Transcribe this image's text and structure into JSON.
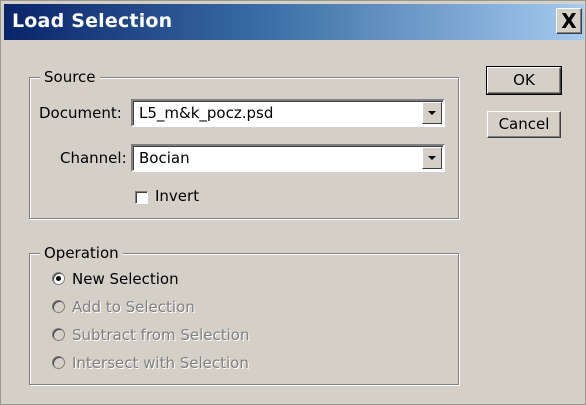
{
  "window": {
    "title": "Load Selection",
    "close_glyph": "X"
  },
  "source": {
    "legend": "Source",
    "document_label": "Document:",
    "document_value": "L5_m&k_pocz.psd",
    "channel_label": "Channel:",
    "channel_value": "Bocian",
    "invert_label": "Invert",
    "invert_checked": false
  },
  "operation": {
    "legend": "Operation",
    "options": [
      {
        "label": "New Selection",
        "selected": true,
        "enabled": true
      },
      {
        "label": "Add to Selection",
        "selected": false,
        "enabled": false
      },
      {
        "label": "Subtract from Selection",
        "selected": false,
        "enabled": false
      },
      {
        "label": "Intersect with Selection",
        "selected": false,
        "enabled": false
      }
    ]
  },
  "buttons": {
    "ok_label": "OK",
    "cancel_label": "Cancel"
  },
  "icons": {
    "close": "close-icon",
    "dropdown": "chevron-down-icon"
  },
  "colors": {
    "titlebar_start": "#0a246a",
    "titlebar_end": "#a6caf0",
    "dialog_face": "#d4d0c8",
    "disabled_text": "#808080"
  }
}
